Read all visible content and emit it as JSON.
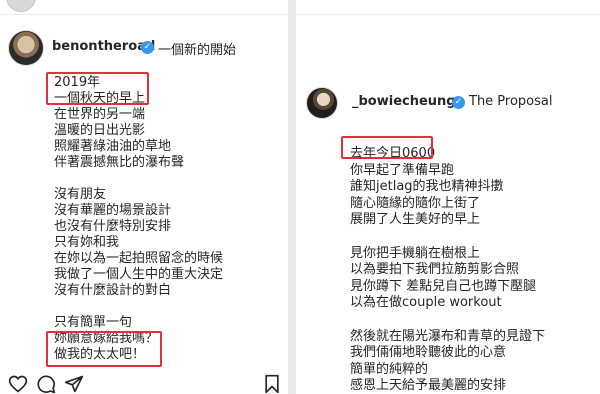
{
  "left_post": {
    "username": "benontheroad",
    "header_text": "一個新的開始",
    "caption_lines": [
      "2019年",
      "一個秋天的早上",
      "在世界的另一端",
      "溫暖的日出光影",
      "照耀著綠油油的草地",
      "伴著震撼無比的瀑布聲",
      "",
      "沒有朋友",
      "沒有華麗的場景設計",
      "也沒有什麼特別安排",
      "只有妳和我",
      "在妳以為一起拍照留念的時候",
      "我做了一個人生中的重大決定",
      "沒有什麼設計的對白",
      "",
      "只有簡單一句",
      "妳願意嫁給我嗎？",
      "做我的太太吧！"
    ],
    "actions": [
      "heart-icon",
      "comment-icon",
      "share-icon",
      "bookmark-icon"
    ]
  },
  "right_post": {
    "username": "_bowiecheung",
    "header_text": "The Proposal",
    "caption_lines": [
      "去年今日0600",
      "你早起了準備早跑",
      "誰知jetlag的我也精神抖擻",
      "隨心隨緣的隨你上街了",
      "展開了人生美好的早上",
      "",
      "見你把手機躺在樹根上",
      "以為要拍下我們拉筋剪影合照",
      "見你蹲下 差點兒自己也蹲下壓腿",
      "以為在做couple workout",
      "",
      "然後就在陽光瀑布和青草的見證下",
      "我們倆倆地聆聽彼此的心意",
      "簡單的純粹的",
      "感恩上天給予最美麗的安排"
    ]
  },
  "colors": {
    "highlight": "#e0303a",
    "verified": "#3897f0",
    "text": "#262626"
  }
}
